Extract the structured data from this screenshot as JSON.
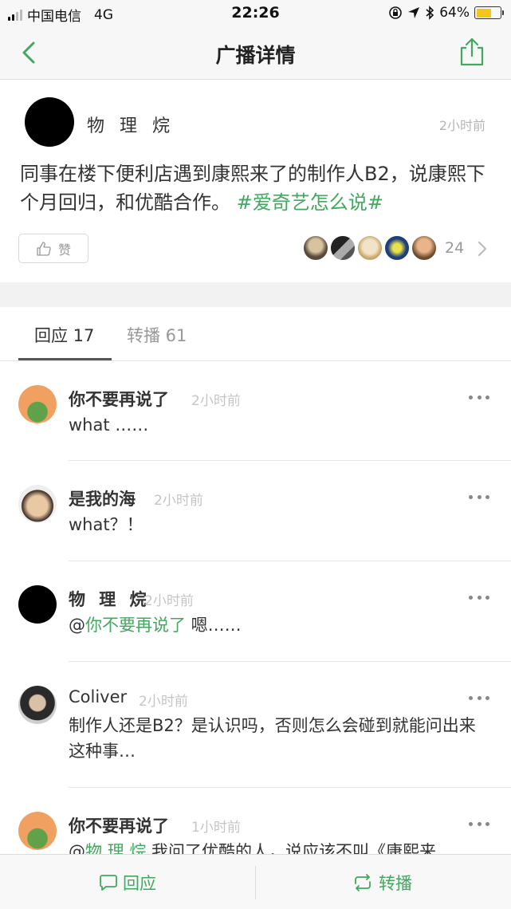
{
  "status_bar": {
    "carrier": "中国电信",
    "network": "4G",
    "time": "22:26",
    "battery": "64%",
    "battery_level": 0.64
  },
  "nav": {
    "title": "广播详情"
  },
  "post": {
    "author": "物 理 烷",
    "time": "2小时前",
    "text": "同事在楼下便利店遇到康熙来了的制作人B2，说康熙下个月回归，和优酷合作。",
    "hashtag": "#爱奇艺怎么说#",
    "like_label": "赞",
    "like_count": "24"
  },
  "tabs": {
    "replies": "回应 17",
    "reposts": "转播 61"
  },
  "comments": [
    {
      "name": "你不要再说了",
      "time": "2小时前",
      "text": "what ……"
    },
    {
      "name": "是我的海",
      "time": "2小时前",
      "text": "what？！"
    },
    {
      "name": "物 理 烷",
      "time": "2小时前",
      "at": "@",
      "mention": "你不要再说了",
      "text": " 嗯……"
    },
    {
      "name": "Coliver",
      "time": "2小时前",
      "text": "制作人还是B2？是认识吗，否则怎么会碰到就能问出来这种事…"
    },
    {
      "name": "你不要再说了",
      "time": "1小时前",
      "at": "@",
      "mention": "物 理 烷",
      "text": " 我问了优酷的人，说应该不叫《康熙来"
    }
  ],
  "bottom_bar": {
    "reply": "回应",
    "repost": "转播"
  },
  "colors": {
    "accent": "#42a85f",
    "background": "#ffffff",
    "separator": "#f2f2f2"
  }
}
